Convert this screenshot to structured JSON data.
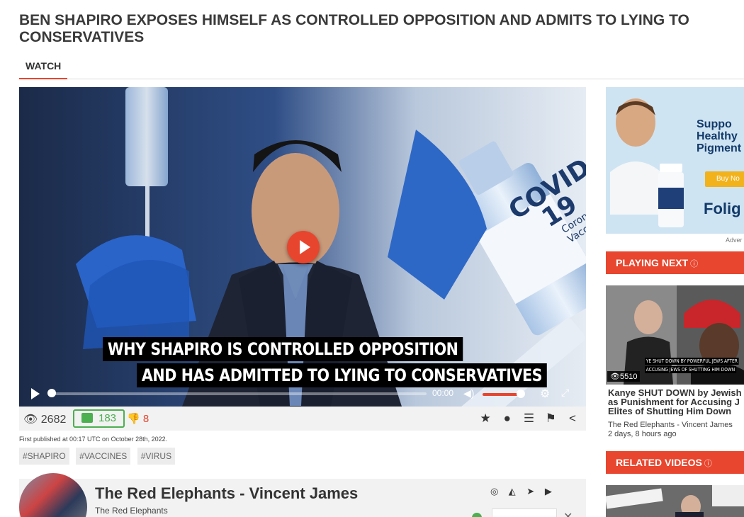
{
  "page": {
    "title_line1": "BEN SHAPIRO EXPOSES HIMSELF AS CONTROLLED OPPOSITION AND ADMITS TO LYING TO",
    "title_line2": "CONSERVATIVES",
    "tab_watch": "WATCH"
  },
  "player": {
    "caption_line1": "WHY SHAPIRO IS CONTROLLED OPPOSITION",
    "caption_line2": "AND HAS ADMITTED TO LYING TO CONSERVATIVES",
    "vial_text1": "COVID",
    "vial_text2": "19",
    "vial_text3": "Coronavirus Vaccine",
    "time": "00:00",
    "progress": 0,
    "volume": 0.9
  },
  "stats": {
    "views": "2682",
    "likes": "183",
    "dislikes": "8",
    "published": "First published at 00:17 UTC on October 28th, 2022."
  },
  "tags": [
    "#SHAPIRO",
    "#VACCINES",
    "#VIRUS"
  ],
  "channel": {
    "name": "The Red Elephants - Vincent James",
    "subname": "The Red Elephants"
  },
  "sidebar": {
    "ad_line1": "Suppo",
    "ad_line2": "Healthy",
    "ad_line3": "Pigment",
    "ad_button": "Buy No",
    "ad_brand": "Folig",
    "ad_label": "Adver",
    "playing_next": "PLAYING NEXT",
    "related_videos": "RELATED VIDEOS",
    "next_video": {
      "views": "5510",
      "strap1": "YE SHUT DOWN BY POWERFUL JEWS AFTER",
      "strap2": "ACCUSING JEWS OF SHUTTING HIM DOWN",
      "title1": "Kanye SHUT DOWN by Jewish",
      "title2": "as Punishment for Accusing J",
      "title3": "Elites of Shutting Him Down",
      "channel": "The Red Elephants - Vincent James",
      "age": "2 days, 8 hours ago"
    }
  },
  "colors": {
    "accent": "#e8462e",
    "like_green": "#4caf50"
  }
}
